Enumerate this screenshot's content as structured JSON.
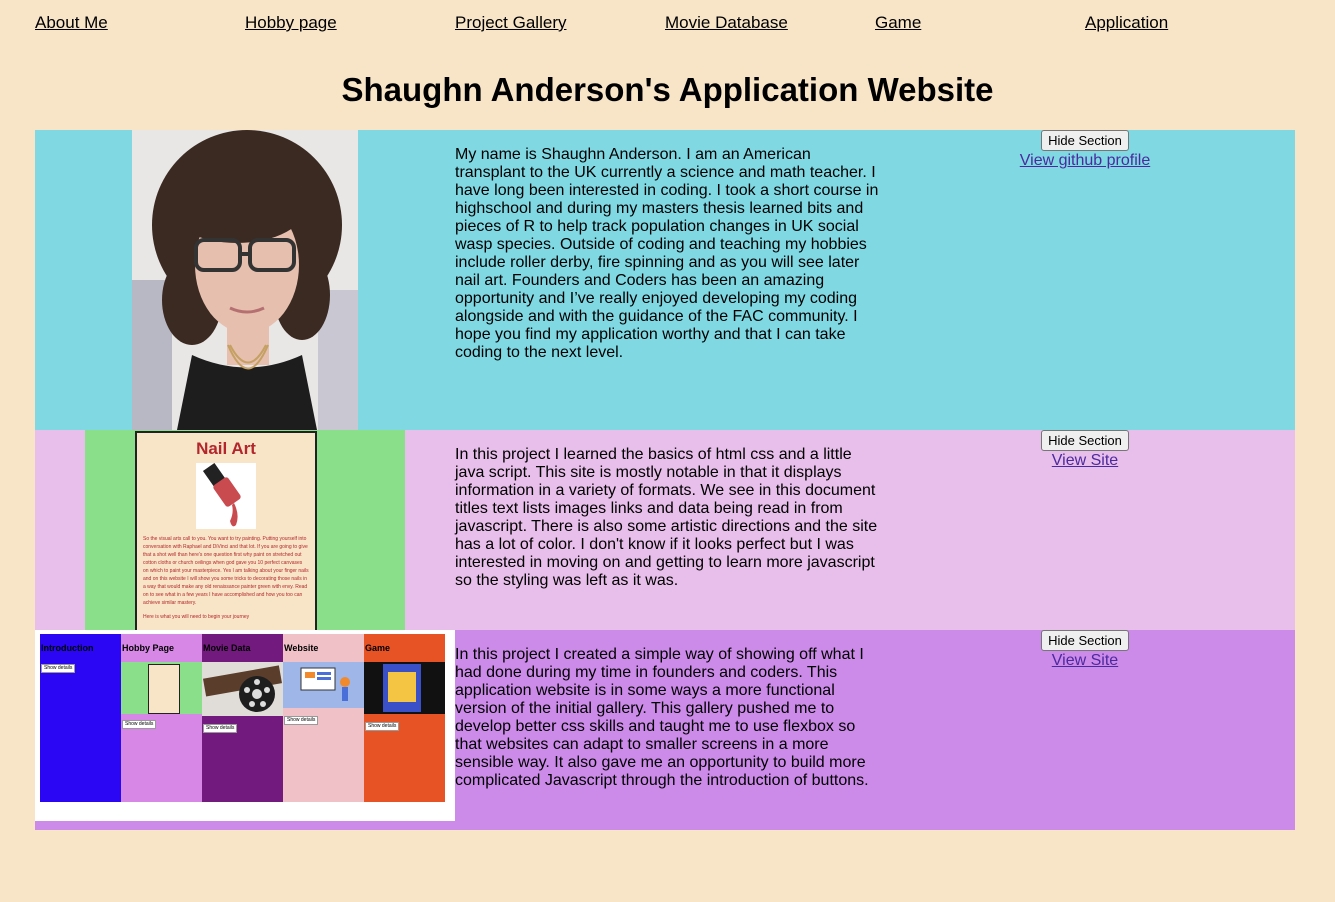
{
  "nav": {
    "items": [
      "About Me",
      "Hobby page",
      "Project Gallery",
      "Movie Database",
      "Game",
      "Application"
    ]
  },
  "page_title": "Shaughn Anderson's Application Website",
  "sections": [
    {
      "bg": "#80d8e3",
      "text": "My name is Shaughn Anderson. I am an American transplant to the UK currently a science and math teacher. I have long been interested in coding. I took a short course in highschool and during my masters thesis learned bits and pieces of R to help track population changes in UK social wasp species. Outside of coding and teaching my hobbies include roller derby, fire spinning and as you will see later nail art. Founders and Coders has been an amazing opportunity and I’ve really enjoyed developing my coding alongside and with the guidance of the FAC community. I hope you find my application worthy and that I can take coding to the next level.",
      "button": "Hide Section",
      "link": "View github profile"
    },
    {
      "bg": "#e8beea",
      "text": "In this project I learned the basics of html css and a little java script. This site is mostly notable in that it displays information in a variety of formats. We see in this document titles text lists images links and data being read in from javascript. There is also some artistic directions and the site has a lot of color. I don't know if it looks perfect but I was interested in moving on and getting to learn more javascript so the styling was left as it was.",
      "button": "Hide Section",
      "link": "View Site",
      "preview": {
        "title": "Nail Art",
        "body": "So the visual arts call to you. You want to try painting. Putting yourself into conversation with Raphael and DiVinci and that lot. If you are going to give that a shot well than here's one question first why paint on stretched out cotton cloths or church ceilings when god gave you 10 perfect canvases on which to paint your masterpiece. Yes I am talking about your finger nails and on this website I will show you some tricks to decorating those nails in a way that would make any old renaissance painter green with envy. Read on to see what in a few years I have accomplished and how you too can achieve similar mastery.",
        "footer": "Here is what you will need to begin your journey"
      }
    },
    {
      "bg": "#cc8ae9",
      "text": "In this project I created a simple way of showing off what I had done during my time in founders and coders. This application website is in some ways a more functional version of the initial gallery. This gallery pushed me to develop better css skills and taught me to use flexbox so that websites can adapt to smaller screens in a more sensible way. It also gave me an opportunity to build more complicated Javascript through the introduction of buttons.",
      "button": "Hide Section",
      "link": "View Site",
      "preview": {
        "columns": [
          {
            "label": "Introduction",
            "color": "#2a06f5",
            "btn": "Show details"
          },
          {
            "label": "Hobby Page",
            "color": "#d788e6",
            "btn": "Show details"
          },
          {
            "label": "Movie Data",
            "color": "#731a7f",
            "btn": "Show details"
          },
          {
            "label": "Website",
            "color": "#f0c2c8",
            "btn": "Show details"
          },
          {
            "label": "Game",
            "color": "#e85326",
            "btn": "Show details"
          }
        ]
      }
    }
  ]
}
